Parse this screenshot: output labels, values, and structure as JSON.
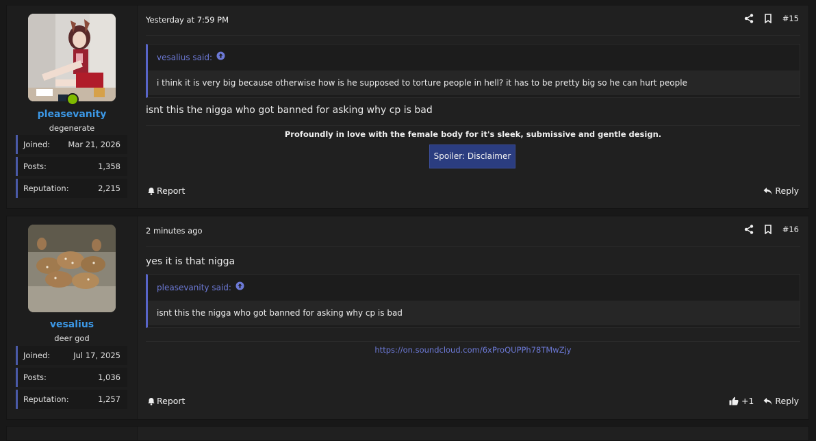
{
  "posts": [
    {
      "author": {
        "name": "pleasevanity",
        "title": "degenerate",
        "online": true
      },
      "stats": [
        {
          "label": "Joined:",
          "value": "Mar 21, 2026"
        },
        {
          "label": "Posts:",
          "value": "1,358"
        },
        {
          "label": "Reputation:",
          "value": "2,215"
        }
      ],
      "time": "Yesterday at 7:59 PM",
      "number": "#15",
      "quote": {
        "author": "vesalius said:",
        "text": "i think it is very big because otherwise how is he supposed to torture people in hell? it has to be pretty big so he can hurt people"
      },
      "message": "isnt this the nigga who got banned for asking why cp is bad",
      "signature": "Profoundly in love with the female body for it's sleek, submissive and gentle design.",
      "spoiler_label": "Spoiler: Disclaimer",
      "report_label": "Report",
      "reply_label": "Reply"
    },
    {
      "author": {
        "name": "vesalius",
        "title": "deer god",
        "online": false
      },
      "stats": [
        {
          "label": "Joined:",
          "value": "Jul 17, 2025"
        },
        {
          "label": "Posts:",
          "value": "1,036"
        },
        {
          "label": "Reputation:",
          "value": "1,257"
        }
      ],
      "time": "2 minutes ago",
      "number": "#16",
      "message": "yes it is that nigga",
      "quote": {
        "author": "pleasevanity said:",
        "text": "isnt this the nigga who got banned for asking why cp is bad"
      },
      "signature_link": "https://on.soundcloud.com/6xProQUPPh78TMwZjy",
      "reaction_count": "+1",
      "report_label": "Report",
      "reply_label": "Reply"
    }
  ],
  "colors": {
    "accent": "#3c98e6",
    "quote_accent": "#5865c8",
    "online": "#7fba00"
  },
  "icons": [
    "share-icon",
    "bookmark-icon",
    "arrow-up-circle-icon",
    "bell-icon",
    "reply-icon",
    "thumbs-up-icon"
  ]
}
